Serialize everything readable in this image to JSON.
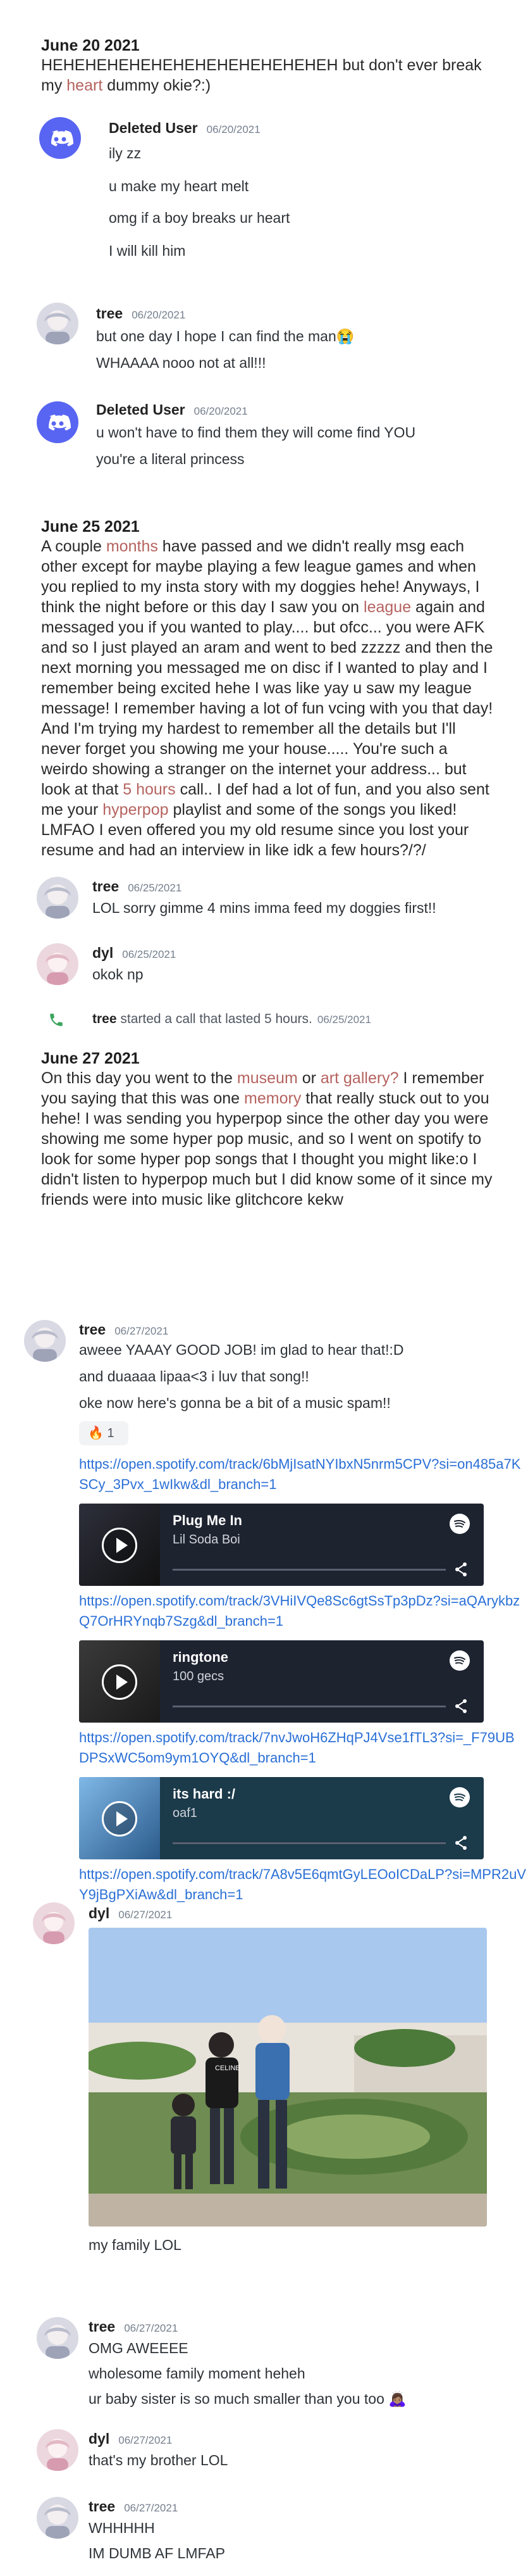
{
  "day1": {
    "title": "June 20 2021",
    "text_a": "HEHEHEHEHEHEHEHEHEHEHEHEHEH but don't ever break my ",
    "text_hl": "heart",
    "text_b": " dummy okie?:)"
  },
  "msg1": {
    "username": "Deleted User",
    "timestamp": "06/20/2021",
    "lines": [
      "ily zz",
      "u make my heart melt",
      "omg if a boy breaks ur heart",
      "I will kill him"
    ]
  },
  "msg2": {
    "username": "tree",
    "timestamp": "06/20/2021",
    "lines": [
      "but one day I hope I can find the man😭",
      "WHAAAA nooo not at all!!!"
    ]
  },
  "msg3": {
    "username": "Deleted User",
    "timestamp": "06/20/2021",
    "lines": [
      "u won't have to find them they will come find YOU",
      "you're a literal princess"
    ]
  },
  "day2": {
    "title": "June 25 2021",
    "p1": "A couple ",
    "h1": "months",
    "p2": " have passed and we didn't really msg each other except for maybe playing a few league games and when you replied to my insta story with my doggies hehe! Anyways, I think the night before or this day I saw you on ",
    "h2": "league",
    "p3": " again and messaged you if you wanted to play.... but ofcc... you were AFK and so I just played an aram and went to bed zzzzz and then the next morning you messaged me on disc if I wanted to play and I remember being excited hehe I was like yay u saw my league message! I remember having a lot of fun vcing with you that day! And I'm trying my hardest to remember all the details but I'll never forget you showing me your house..... You're such a weirdo showing a stranger on the internet your address... but look at that ",
    "h3": "5 hours",
    "p4": " call.. I def had a lot of fun, and you also sent me your ",
    "h4": "hyperpop",
    "p5": " playlist and some of the songs you liked! LMFAO I even offered you my old resume since you lost your resume and had an interview in like idk a few hours?/?/"
  },
  "msg4": {
    "username": "tree",
    "timestamp": "06/25/2021",
    "lines": [
      "LOL sorry gimme 4 mins imma feed my doggies first!!"
    ]
  },
  "msg5": {
    "username": "dyl",
    "timestamp": "06/25/2021",
    "lines": [
      "okok np"
    ]
  },
  "call": {
    "user": "tree",
    "text": " started a call that lasted 5 hours.",
    "timestamp": "06/25/2021"
  },
  "day3": {
    "title": "June 27 2021",
    "p1": "On this day you went to the ",
    "h1": "museum",
    "p2": " or ",
    "h2": "art gallery?",
    "p3": " I remember you saying that this was one ",
    "h3": "memory",
    "p4": " that really stuck out to you hehe! I was sending you hyperpop since the other day you were showing me some hyper pop music, and so I went on spotify to look for some hyper pop songs that I thought you might like:o I didn't listen to hyperpop much but I did know some of it since my friends were into music like glitchcore kekw"
  },
  "msg6": {
    "username": "tree",
    "timestamp": "06/27/2021",
    "lines": [
      "aweee YAAAY GOOD JOB! im glad to hear that!:D",
      "and duaaaa lipaa<3 i luv that song!!",
      "oke now here's gonna be a bit of a music spam!!"
    ],
    "reaction_emoji": "🔥",
    "reaction_count": "1",
    "links": [
      "https://open.spotify.com/track/6bMjIsatNYIbxN5nrm5CPV?si=on485a7KSCy_3Pvx_1wIkw&dl_branch=1",
      "https://open.spotify.com/track/3VHiIVQe8Sc6gtSsTp3pDz?si=aQArykbzQ7OrHRYnqb7Szg&dl_branch=1",
      "https://open.spotify.com/track/7nvJwoH6ZHqPJ4Vse1fTL3?si=_F79UBDPSxWC5om9ym1OYQ&dl_branch=1",
      "https://open.spotify.com/track/7A8v5E6qmtGyLEOoICDaLP?si=MPR2uVY9jBgPXiAw&dl_branch=1"
    ],
    "embeds": [
      {
        "title": "Plug Me In",
        "artist": "Lil Soda Boi"
      },
      {
        "title": "ringtone",
        "artist": "100 gecs"
      },
      {
        "title": "its hard :/",
        "artist": "oaf1"
      }
    ]
  },
  "msg7": {
    "username": "dyl",
    "timestamp": "06/27/2021",
    "photo_text": "CELINE",
    "caption": "my family LOL"
  },
  "msg8": {
    "username": "tree",
    "timestamp": "06/27/2021",
    "lines": [
      "OMG AWEEEE",
      "wholesome family moment heheh",
      "ur baby sister is so much smaller than you too 🙇🏽‍♀️"
    ]
  },
  "msg9": {
    "username": "dyl",
    "timestamp": "06/27/2021",
    "lines": [
      "that's my brother LOL"
    ]
  },
  "msg10": {
    "username": "tree",
    "timestamp": "06/27/2021",
    "lines": [
      "WHHHHH",
      "IM DUMB AF LMFAP"
    ]
  }
}
